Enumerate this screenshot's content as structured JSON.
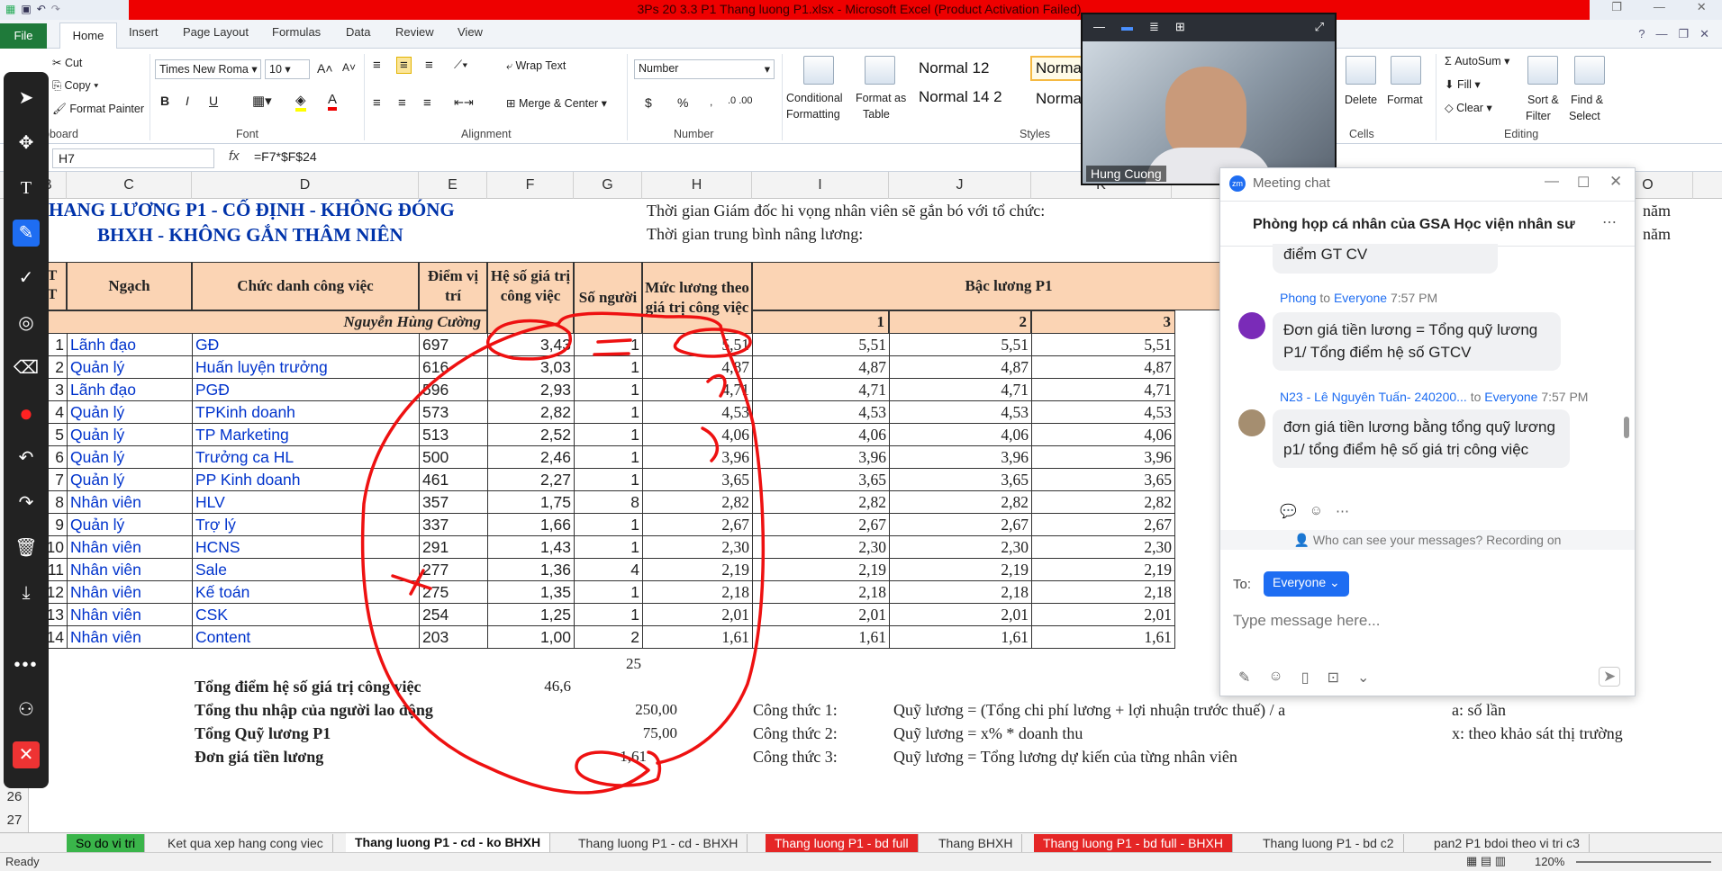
{
  "window": {
    "title": "3Ps 20 3.3 P1 Thang luong P1.xlsx  -  Microsoft Excel (Product Activation Failed)"
  },
  "ribbon": {
    "tabs": [
      "Home",
      "Insert",
      "Page Layout",
      "Formulas",
      "Data",
      "Review",
      "View"
    ],
    "file": "File",
    "clipboard": {
      "cut": "Cut",
      "copy": "Copy",
      "painter": "Format Painter",
      "label": "pboard"
    },
    "font": {
      "name": "Times New Roma",
      "size": "10",
      "label": "Font",
      "bold": "B",
      "italic": "I",
      "underline": "U"
    },
    "alignment": {
      "wrap": "Wrap Text",
      "merge": "Merge & Center",
      "label": "Alignment"
    },
    "number": {
      "format": "Number",
      "label": "Number",
      "currency": "$",
      "percent": "%"
    },
    "styles": {
      "conditional": "Conditional",
      "conditional2": "Formatting",
      "format_as": "Format as",
      "format_as2": "Table",
      "normal12": "Normal 12",
      "normal14": "Normal 14 2",
      "normal_a": "Norma",
      "normal_b": "Norma",
      "label": "Styles"
    },
    "cells": {
      "delete": "Delete",
      "format": "Format",
      "label": "Cells"
    },
    "editing": {
      "autosum": "AutoSum",
      "fill": "Fill",
      "clear": "Clear",
      "sort": "Sort &",
      "sort2": "Filter",
      "find": "Find &",
      "find2": "Select",
      "label": "Editing"
    }
  },
  "formula_bar": {
    "name_box": "H7",
    "fx": "fx",
    "formula": "=F7*$F$24"
  },
  "columns": [
    "B",
    "C",
    "D",
    "E",
    "F",
    "G",
    "H",
    "I",
    "J",
    "K",
    "O"
  ],
  "rows": [
    "3",
    "4",
    "5",
    "6",
    "7",
    "8",
    "9",
    "10",
    "11",
    "12",
    "13",
    "14",
    "15",
    "16",
    "17",
    "18",
    "19",
    "20",
    "21",
    "22",
    "23",
    "24",
    "25",
    "26",
    "27"
  ],
  "sheet": {
    "title1": "HANG LƯƠNG P1 - CỐ ĐỊNH - KHÔNG ĐÓNG",
    "title2": "BHXH - KHÔNG GẮN THÂM NIÊN",
    "note1": "Thời gian Giám đốc hi vọng nhân viên sẽ gắn bó với tổ chức:",
    "note2": "Thời gian trung bình nâng lương:",
    "nam1": "năm",
    "nam2": "năm",
    "hdr_tt": "T\nT",
    "hdr_ngach": "Ngạch",
    "hdr_chucdanh": "Chức danh công việc",
    "hdr_diem": "Điểm vị trí",
    "hdr_heso": "Hệ số giá trị công việc",
    "hdr_songuoi": "Số người",
    "hdr_muc": "Mức lương theo giá trị công việc",
    "hdr_bac": "Bậc lương P1",
    "author": "Nguyễn Hùng  Cường",
    "bac_nums": [
      "1",
      "2",
      "3"
    ],
    "data": [
      {
        "n": "1",
        "ngach": "Lãnh đạo",
        "cd": "GĐ",
        "diem": "697",
        "heso": "3,43",
        "so": "1",
        "muc": "5,51",
        "b1": "5,51",
        "b2": "5,51",
        "b3": "5,51"
      },
      {
        "n": "2",
        "ngach": "Quản lý",
        "cd": "Huấn luyện trưởng",
        "diem": "616",
        "heso": "3,03",
        "so": "1",
        "muc": "4,87",
        "b1": "4,87",
        "b2": "4,87",
        "b3": "4,87"
      },
      {
        "n": "3",
        "ngach": "Lãnh đạo",
        "cd": "PGĐ",
        "diem": "596",
        "heso": "2,93",
        "so": "1",
        "muc": "4,71",
        "b1": "4,71",
        "b2": "4,71",
        "b3": "4,71"
      },
      {
        "n": "4",
        "ngach": "Quản lý",
        "cd": "TPKinh doanh",
        "diem": "573",
        "heso": "2,82",
        "so": "1",
        "muc": "4,53",
        "b1": "4,53",
        "b2": "4,53",
        "b3": "4,53"
      },
      {
        "n": "5",
        "ngach": "Quản lý",
        "cd": "TP Marketing",
        "diem": "513",
        "heso": "2,52",
        "so": "1",
        "muc": "4,06",
        "b1": "4,06",
        "b2": "4,06",
        "b3": "4,06"
      },
      {
        "n": "6",
        "ngach": "Quản lý",
        "cd": "Trưởng ca HL",
        "diem": "500",
        "heso": "2,46",
        "so": "1",
        "muc": "3,96",
        "b1": "3,96",
        "b2": "3,96",
        "b3": "3,96"
      },
      {
        "n": "7",
        "ngach": "Quản lý",
        "cd": "PP Kinh doanh",
        "diem": "461",
        "heso": "2,27",
        "so": "1",
        "muc": "3,65",
        "b1": "3,65",
        "b2": "3,65",
        "b3": "3,65"
      },
      {
        "n": "8",
        "ngach": "Nhân viên",
        "cd": "HLV",
        "diem": "357",
        "heso": "1,75",
        "so": "8",
        "muc": "2,82",
        "b1": "2,82",
        "b2": "2,82",
        "b3": "2,82"
      },
      {
        "n": "9",
        "ngach": "Quản lý",
        "cd": "Trợ lý",
        "diem": "337",
        "heso": "1,66",
        "so": "1",
        "muc": "2,67",
        "b1": "2,67",
        "b2": "2,67",
        "b3": "2,67"
      },
      {
        "n": "10",
        "ngach": "Nhân viên",
        "cd": "HCNS",
        "diem": "291",
        "heso": "1,43",
        "so": "1",
        "muc": "2,30",
        "b1": "2,30",
        "b2": "2,30",
        "b3": "2,30"
      },
      {
        "n": "11",
        "ngach": "Nhân viên",
        "cd": "Sale",
        "diem": "277",
        "heso": "1,36",
        "so": "4",
        "muc": "2,19",
        "b1": "2,19",
        "b2": "2,19",
        "b3": "2,19"
      },
      {
        "n": "12",
        "ngach": "Nhân viên",
        "cd": "Kế toán",
        "diem": "275",
        "heso": "1,35",
        "so": "1",
        "muc": "2,18",
        "b1": "2,18",
        "b2": "2,18",
        "b3": "2,18"
      },
      {
        "n": "13",
        "ngach": "Nhân viên",
        "cd": "CSK",
        "diem": "254",
        "heso": "1,25",
        "so": "1",
        "muc": "2,01",
        "b1": "2,01",
        "b2": "2,01",
        "b3": "2,01"
      },
      {
        "n": "14",
        "ngach": "Nhân viên",
        "cd": "Content",
        "diem": "203",
        "heso": "1,00",
        "so": "2",
        "muc": "1,61",
        "b1": "1,61",
        "b2": "1,61",
        "b3": "1,61"
      }
    ],
    "total_people": "25",
    "sum1_label": "Tổng điểm hệ số giá trị công việc",
    "sum1_val": "46,6",
    "sum2_label": "Tổng thu nhập của người lao động",
    "sum2_val": "250,00",
    "sum3_label": "Tổng Quỹ lương P1",
    "sum3_val": "75,00",
    "sum4_label": "Đơn giá tiền lương",
    "sum4_val": "1,61",
    "f1_label": "Công thức 1:",
    "f1": "Quỹ lương = (Tổng chi phí lương + lợi nhuận trước thuế) / a",
    "f1_note": "a: số lần",
    "f2_label": "Công thức 2:",
    "f2": "Quỹ lương = x% * doanh thu",
    "f2_note": "x: theo khảo sát thị trường",
    "f3_label": "Công thức 3:",
    "f3": "Quỹ lương = Tổng lương dự kiến của từng nhân viên"
  },
  "sheet_tabs": [
    "So do vi tri",
    "Ket qua xep hang cong viec",
    "Thang luong P1 - cd - ko BHXH",
    "Thang luong P1 - cd - BHXH",
    "Thang luong P1 - bd full",
    "Thang BHXH",
    "Thang luong P1 - bd full - BHXH",
    "Thang luong P1 - bd c2",
    "pan2 P1 bdoi theo vi tri c3"
  ],
  "status": {
    "ready": "Ready",
    "zoom": "120%"
  },
  "video": {
    "name": "Hung Cuong"
  },
  "chat": {
    "title": "Meeting chat",
    "room": "Phòng họp cá nhân của GSA Học viện nhân sư",
    "prev_tail": "điểm GT CV",
    "m1_from": "Phong",
    "m1_to": "to",
    "m1_target": "Everyone",
    "m1_time": "7:57 PM",
    "m1_text": "Đơn giá tiền lương = Tổng quỹ lương P1/ Tổng điểm hệ số GTCV",
    "m2_from": "N23 - Lê Nguyên Tuấn- 240200...",
    "m2_to": "to",
    "m2_target": "Everyone",
    "m2_time": "7:57 PM",
    "m2_text": "đơn giá tiền lương bằng tổng quỹ lương p1/ tổng điểm hệ số giá trị công việc",
    "privacy": "Who can see your messages? Recording on",
    "to_label": "To:",
    "to_value": "Everyone",
    "placeholder": "Type message here..."
  }
}
